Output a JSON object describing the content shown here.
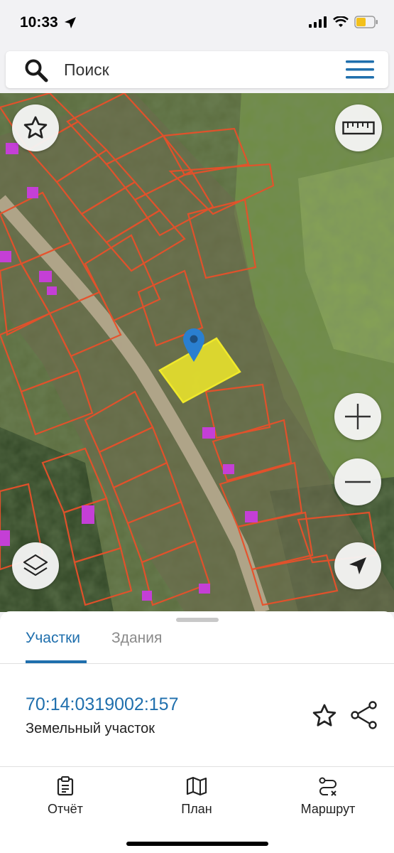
{
  "status": {
    "time": "10:33"
  },
  "search": {
    "placeholder": "Поиск"
  },
  "sheet": {
    "tabs": [
      {
        "label": "Участки",
        "active": true
      },
      {
        "label": "Здания",
        "active": false
      }
    ],
    "parcel": {
      "number": "70:14:0319002:157",
      "type": "Земельный участок"
    }
  },
  "nav": {
    "items": [
      {
        "label": "Отчёт",
        "icon": "clipboard-icon"
      },
      {
        "label": "План",
        "icon": "map-icon"
      },
      {
        "label": "Маршрут",
        "icon": "route-icon"
      }
    ]
  },
  "colors": {
    "accent": "#1f6fad",
    "parcel_border": "#e8502a",
    "selected_parcel": "#f0e92a",
    "building_marker": "#c43fd6",
    "map_pin": "#2a7fd0"
  }
}
